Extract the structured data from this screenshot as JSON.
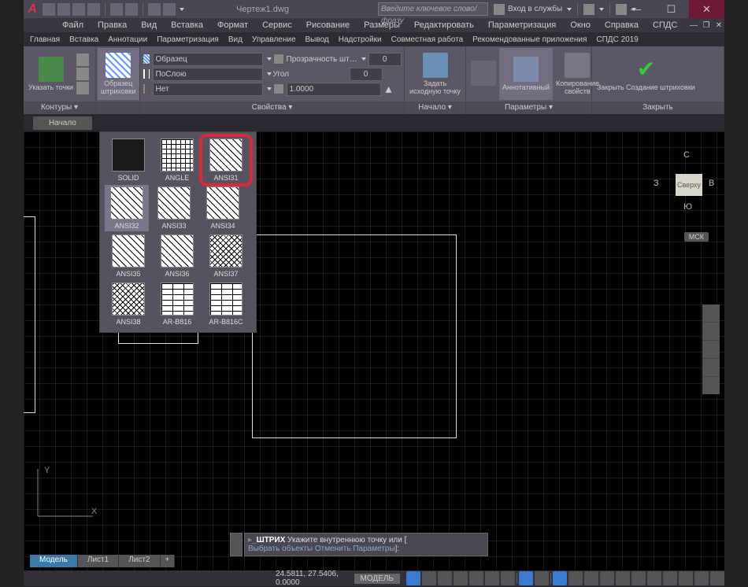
{
  "titlebar": {
    "title": "Чертеж1.dwg",
    "search_placeholder": "Введите ключевое слово/фразу",
    "login": "Вход в службы"
  },
  "menu": [
    "Файл",
    "Правка",
    "Вид",
    "Вставка",
    "Формат",
    "Сервис",
    "Рисование",
    "Размеры",
    "Редактировать",
    "Параметризация",
    "Окно",
    "Справка",
    "СПДС"
  ],
  "ribbon_tabs": [
    "Главная",
    "Вставка",
    "Аннотации",
    "Параметризация",
    "Вид",
    "Управление",
    "Вывод",
    "Надстройки",
    "Совместная работа",
    "Рекомендованные приложения",
    "СПДС 2019"
  ],
  "panels": {
    "contours": {
      "title": "Контуры ▾",
      "specify_points": "Указать точки"
    },
    "pattern": {
      "big": "Образец штриховки"
    },
    "properties": {
      "title": "Свойства ▾",
      "type": "Образец",
      "color": "ПоСлою",
      "bg": "Нет",
      "trans_label": "Прозрачность шт…",
      "trans_val": "0",
      "angle_label": "Угол",
      "angle_val": "0",
      "scale_val": "1.0000"
    },
    "origin": {
      "title": "Начало ▾",
      "btn": "Задать исходную точку"
    },
    "options": {
      "title": "Параметры ▾",
      "annot": "Аннотативный",
      "copy": "Копирование свойств"
    },
    "close": {
      "title": "Закрыть",
      "btn": "Закрыть Создание штриховки"
    }
  },
  "doc_tab": "Начало",
  "patterns": [
    {
      "name": "SOLID",
      "cls": "hatch-solid"
    },
    {
      "name": "ANGLE",
      "cls": "hatch-grid"
    },
    {
      "name": "ANSI31",
      "cls": "hatch-lines",
      "highlight": true
    },
    {
      "name": "ANSI32",
      "cls": "hatch-lines",
      "selected": true
    },
    {
      "name": "ANSI33",
      "cls": "hatch-lines"
    },
    {
      "name": "ANSI34",
      "cls": "hatch-lines"
    },
    {
      "name": "ANSI35",
      "cls": "hatch-lines"
    },
    {
      "name": "ANSI36",
      "cls": "hatch-lines"
    },
    {
      "name": "ANSI37",
      "cls": "hatch-cross"
    },
    {
      "name": "ANSI38",
      "cls": "hatch-cross"
    },
    {
      "name": "AR-B816",
      "cls": "hatch-brick"
    },
    {
      "name": "AR-B816C",
      "cls": "hatch-brick"
    }
  ],
  "viewcube": {
    "center": "Сверху",
    "n": "С",
    "s": "Ю",
    "e": "В",
    "w": "З",
    "wcs": "МСК"
  },
  "cmdline": {
    "l1_cmd": "ШТРИХ",
    "l1_rest": " Укажите внутреннюю точку или [",
    "l2": "Выбрать объекты Отменить Параметры",
    "l2_end": "]:"
  },
  "layout_tabs": [
    "Модель",
    "Лист1",
    "Лист2"
  ],
  "status": {
    "coords": "24.5811, 27.5406, 0.0000",
    "model": "МОДЕЛЬ"
  }
}
